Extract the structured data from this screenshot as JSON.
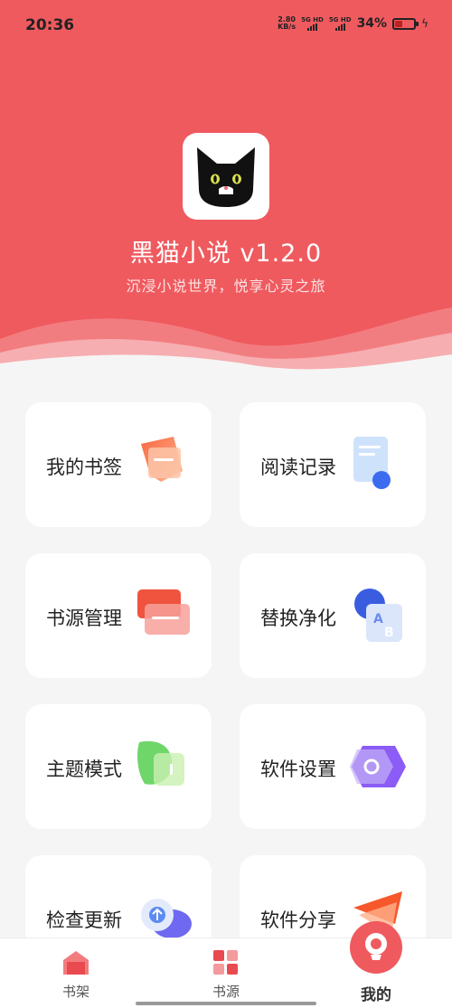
{
  "status_bar": {
    "time": "20:36",
    "net_speed_value": "2.80",
    "net_speed_unit": "KB/s",
    "sim1": "5G HD",
    "sim2": "5G HD",
    "battery_percent": "34%",
    "battery_level": 0.34
  },
  "header": {
    "app_title": "黑猫小说 v1.2.0",
    "slogan": "沉浸小说世界，悦享心灵之旅",
    "logo_icon": "black-cat-logo",
    "bg_color": "#ef5a5f"
  },
  "menu": [
    {
      "label": "我的书签",
      "icon": "bookmark-icon"
    },
    {
      "label": "阅读记录",
      "icon": "reading-record-icon"
    },
    {
      "label": "书源管理",
      "icon": "source-manage-icon"
    },
    {
      "label": "替换净化",
      "icon": "replace-icon"
    },
    {
      "label": "主题模式",
      "icon": "theme-icon"
    },
    {
      "label": "软件设置",
      "icon": "settings-icon"
    },
    {
      "label": "检查更新",
      "icon": "cloud-update-icon"
    },
    {
      "label": "软件分享",
      "icon": "share-icon"
    }
  ],
  "bottom_nav": {
    "items": [
      {
        "label": "书架",
        "icon": "bookshelf-icon"
      },
      {
        "label": "书源",
        "icon": "book-source-icon"
      },
      {
        "label": "我的",
        "icon": "profile-icon"
      }
    ],
    "active_index": 2
  }
}
